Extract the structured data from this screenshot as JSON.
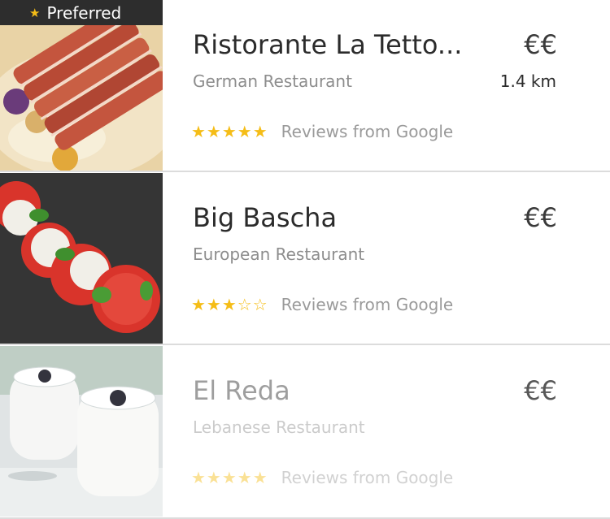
{
  "restaurants": [
    {
      "badge": "Preferred",
      "name": "Ristorante La Tetto...",
      "price": "€€",
      "category": "German Restaurant",
      "distance": "1.4 km",
      "rating": 5,
      "stars": "★★★★★",
      "reviews_label": "Reviews from Google",
      "image": "grilled-duck-breast-photo"
    },
    {
      "name": "Big Bascha",
      "price": "€€",
      "category": "European Restaurant",
      "rating": 3,
      "stars": "★★★☆☆",
      "reviews_label": "Reviews from Google",
      "image": "caprese-salad-photo"
    },
    {
      "name": "El Reda",
      "price": "€€",
      "category": "Lebanese Restaurant",
      "rating": 5,
      "stars": "★★★★★",
      "reviews_label": "Reviews from Google",
      "image": "yogurt-jars-photo"
    }
  ],
  "colors": {
    "star": "#f5bd17",
    "title": "#2b2b2b",
    "secondary": "#8d8d8d",
    "badge_bg": "#2d2d2d"
  }
}
